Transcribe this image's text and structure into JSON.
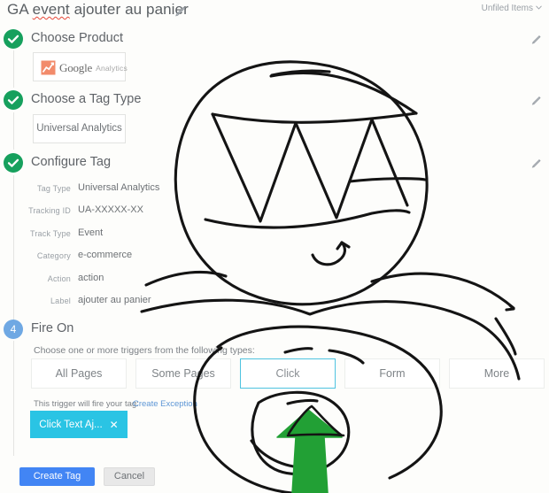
{
  "header": {
    "title_prefix": "GA ",
    "title_misspelled": "event",
    "title_suffix": " ajouter au panier",
    "edit_icon": "pencil-icon",
    "workspace": "Unfiled Items",
    "workspace_chevron": "chevron-down-icon"
  },
  "steps": [
    {
      "badge": "check-icon",
      "number": "",
      "title": "Choose Product",
      "state": "complete",
      "edit_icon": "pencil-icon"
    },
    {
      "badge": "check-icon",
      "number": "",
      "title": "Choose a Tag Type",
      "state": "complete",
      "edit_icon": "pencil-icon"
    },
    {
      "badge": "check-icon",
      "number": "",
      "title": "Configure Tag",
      "state": "complete",
      "edit_icon": "pencil-icon"
    },
    {
      "badge": "number",
      "number": "4",
      "title": "Fire On",
      "state": "active",
      "edit_icon": ""
    }
  ],
  "product": {
    "logo_mark": "google-analytics-icon",
    "brand": "Google",
    "product_name": "Analytics"
  },
  "tag_type": {
    "value": "Universal Analytics"
  },
  "configure_tag": {
    "fields": [
      {
        "label": "Tag Type",
        "value": "Universal Analytics"
      },
      {
        "label": "Tracking ID",
        "value": "UA-XXXXX-XX"
      },
      {
        "label": "Track Type",
        "value": "Event"
      },
      {
        "label": "Category",
        "value": "e-commerce"
      },
      {
        "label": "Action",
        "value": "action"
      },
      {
        "label": "Label",
        "value": "ajouter au panier"
      }
    ]
  },
  "fire_on": {
    "hint": "Choose one or more triggers from the following types:",
    "triggers": [
      {
        "label": "All Pages",
        "selected": false
      },
      {
        "label": "Some Pages",
        "selected": false
      },
      {
        "label": "Click",
        "selected": true
      },
      {
        "label": "Form",
        "selected": false
      },
      {
        "label": "More",
        "selected": false
      }
    ],
    "fire_text": "This trigger will fire your tag:",
    "exception_link": "Create Exception",
    "chip": {
      "label": "Click Text Aj...",
      "remove_icon": "close-icon"
    }
  },
  "footer": {
    "create_label": "Create Tag",
    "cancel_label": "Cancel"
  },
  "colors": {
    "page_background": "#fdfdfb",
    "complete_badge": "#16a05d",
    "active_badge": "#6fa8e3",
    "selected_trigger_border": "#4ec3e0",
    "chip_background": "#2ac4e4",
    "primary_button": "#4285f4",
    "link": "#5e97d6",
    "doodle_stroke": "#141414",
    "doodle_arrow_fill": "#22a035"
  },
  "annotation": {
    "kind": "hand-drawn-doodle-overlay",
    "description": "Black freehand drawing of a large face with arrow pointing at the Click trigger button"
  }
}
